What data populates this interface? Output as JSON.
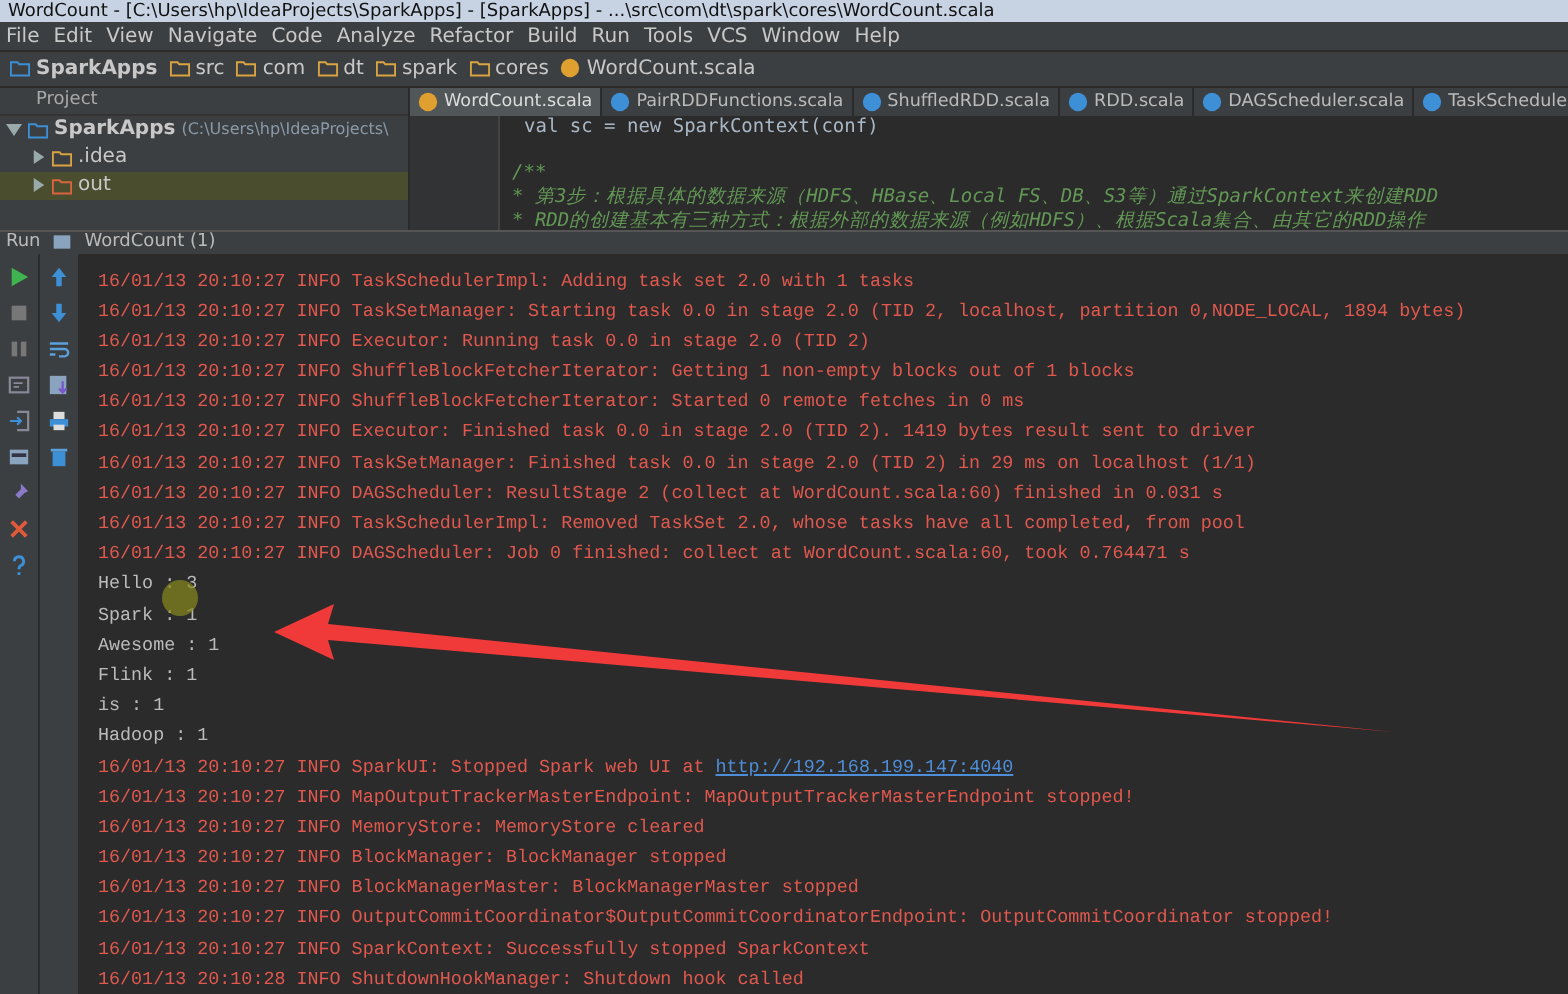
{
  "window": {
    "title": "WordCount - [C:\\Users\\hp\\IdeaProjects\\SparkApps] - [SparkApps] - ...\\src\\com\\dt\\spark\\cores\\WordCount.scala"
  },
  "menu": [
    "File",
    "Edit",
    "View",
    "Navigate",
    "Code",
    "Analyze",
    "Refactor",
    "Build",
    "Run",
    "Tools",
    "VCS",
    "Window",
    "Help"
  ],
  "breadcrumbs": [
    {
      "label": "SparkApps",
      "kind": "project"
    },
    {
      "label": "src",
      "kind": "folder"
    },
    {
      "label": "com",
      "kind": "folder"
    },
    {
      "label": "dt",
      "kind": "folder"
    },
    {
      "label": "spark",
      "kind": "folder"
    },
    {
      "label": "cores",
      "kind": "folder"
    },
    {
      "label": "WordCount.scala",
      "kind": "file"
    }
  ],
  "project_panel": {
    "title": "Project",
    "root": {
      "label": "SparkApps",
      "path": "(C:\\Users\\hp\\IdeaProjects\\",
      "expanded": true,
      "children": [
        {
          "label": ".idea",
          "selected": false,
          "expanded": false
        },
        {
          "label": "out",
          "selected": true,
          "expanded": false
        }
      ]
    }
  },
  "tabs": [
    {
      "label": "WordCount.scala",
      "selected": true,
      "kind": "object"
    },
    {
      "label": "PairRDDFunctions.scala",
      "selected": false,
      "kind": "class"
    },
    {
      "label": "ShuffledRDD.scala",
      "selected": false,
      "kind": "class"
    },
    {
      "label": "RDD.scala",
      "selected": false,
      "kind": "class"
    },
    {
      "label": "DAGScheduler.scala",
      "selected": false,
      "kind": "class"
    },
    {
      "label": "TaskSchedule",
      "selected": false,
      "kind": "class"
    }
  ],
  "editor": {
    "lines": [
      {
        "kind": "code",
        "text": "val sc = new SparkContext(conf)"
      },
      {
        "kind": "comment_start",
        "text": "/**"
      },
      {
        "kind": "comment",
        "text": "  * 第3步：根据具体的数据来源（HDFS、HBase、Local FS、DB、S3等）通过SparkContext来创建RDD"
      },
      {
        "kind": "comment",
        "text": "  * RDD的创建基本有三种方式：根据外部的数据来源（例如HDFS）、根据Scala集合、由其它的RDD操作"
      }
    ]
  },
  "run_panel": {
    "label": "Run",
    "config": "WordCount (1)",
    "lines": [
      {
        "kind": "log",
        "text": "16/01/13 20:10:27 INFO TaskSchedulerImpl: Adding task set 2.0 with 1 tasks"
      },
      {
        "kind": "log",
        "text": "16/01/13 20:10:27 INFO TaskSetManager: Starting task 0.0 in stage 2.0 (TID 2, localhost, partition 0,NODE_LOCAL, 1894 bytes)"
      },
      {
        "kind": "log",
        "text": "16/01/13 20:10:27 INFO Executor: Running task 0.0 in stage 2.0 (TID 2)"
      },
      {
        "kind": "log",
        "text": "16/01/13 20:10:27 INFO ShuffleBlockFetcherIterator: Getting 1 non-empty blocks out of 1 blocks"
      },
      {
        "kind": "log",
        "text": "16/01/13 20:10:27 INFO ShuffleBlockFetcherIterator: Started 0 remote fetches in 0 ms"
      },
      {
        "kind": "log",
        "text": "16/01/13 20:10:27 INFO Executor: Finished task 0.0 in stage 2.0 (TID 2). 1419 bytes result sent to driver"
      },
      {
        "kind": "log",
        "text": "16/01/13 20:10:27 INFO TaskSetManager: Finished task 0.0 in stage 2.0 (TID 2) in 29 ms on localhost (1/1)"
      },
      {
        "kind": "log",
        "text": "16/01/13 20:10:27 INFO DAGScheduler: ResultStage 2 (collect at WordCount.scala:60) finished in 0.031 s"
      },
      {
        "kind": "log",
        "text": "16/01/13 20:10:27 INFO TaskSchedulerImpl: Removed TaskSet 2.0, whose tasks have all completed, from pool"
      },
      {
        "kind": "log",
        "text": "16/01/13 20:10:27 INFO DAGScheduler: Job 0 finished: collect at WordCount.scala:60, took 0.764471 s"
      },
      {
        "kind": "output",
        "text": "Hello : 3"
      },
      {
        "kind": "output",
        "text": "Spark : 1"
      },
      {
        "kind": "output",
        "text": "Awesome : 1"
      },
      {
        "kind": "output",
        "text": "Flink : 1"
      },
      {
        "kind": "output",
        "text": "is : 1"
      },
      {
        "kind": "output",
        "text": "Hadoop : 1"
      },
      {
        "kind": "log",
        "text": "16/01/13 20:10:27 INFO SparkUI: Stopped Spark web UI at ",
        "link": "http://192.168.199.147:4040"
      },
      {
        "kind": "log",
        "text": "16/01/13 20:10:27 INFO MapOutputTrackerMasterEndpoint: MapOutputTrackerMasterEndpoint stopped!"
      },
      {
        "kind": "log",
        "text": "16/01/13 20:10:27 INFO MemoryStore: MemoryStore cleared"
      },
      {
        "kind": "log",
        "text": "16/01/13 20:10:27 INFO BlockManager: BlockManager stopped"
      },
      {
        "kind": "log",
        "text": "16/01/13 20:10:27 INFO BlockManagerMaster: BlockManagerMaster stopped"
      },
      {
        "kind": "log",
        "text": "16/01/13 20:10:27 INFO OutputCommitCoordinator$OutputCommitCoordinatorEndpoint: OutputCommitCoordinator stopped!"
      },
      {
        "kind": "log",
        "text": "16/01/13 20:10:27 INFO SparkContext: Successfully stopped SparkContext"
      },
      {
        "kind": "log",
        "text": "16/01/13 20:10:28 INFO ShutdownHookManager: Shutdown hook called"
      }
    ]
  }
}
